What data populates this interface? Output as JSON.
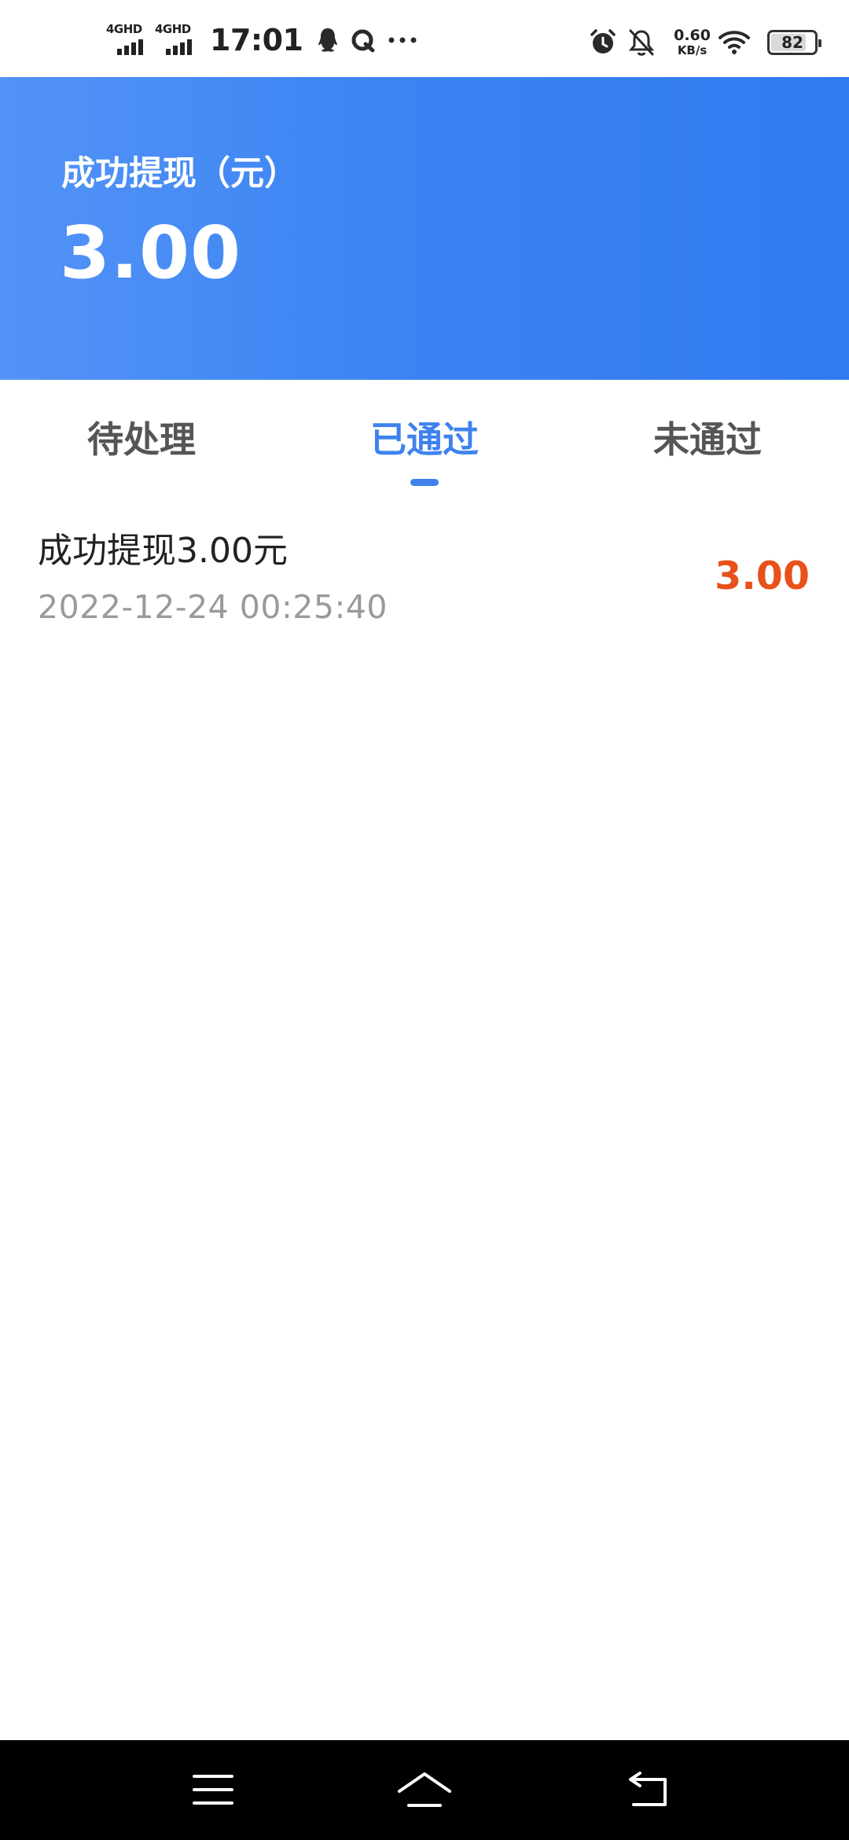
{
  "status_bar": {
    "signal_1_label": "4GHD",
    "signal_2_label": "4GHD",
    "time": "17:01",
    "notification_icons": [
      "qq-icon",
      "browser-icon",
      "more-dots-icon"
    ],
    "net_speed_value": "0.60",
    "net_speed_unit": "KB/s",
    "battery_level": "82",
    "battery_fraction": 0.82
  },
  "summary": {
    "label": "成功提现（元）",
    "amount": "3.00"
  },
  "tabs": [
    {
      "label": "待处理",
      "active": false
    },
    {
      "label": "已通过",
      "active": true
    },
    {
      "label": "未通过",
      "active": false
    }
  ],
  "records": [
    {
      "title": "成功提现3.00元",
      "date": "2022-12-24 00:25:40",
      "amount": "3.00"
    }
  ],
  "nav_bar": {
    "icons": [
      "menu-icon",
      "home-icon",
      "back-icon"
    ]
  },
  "colors": {
    "banner_gradient_start": "#5393f7",
    "banner_gradient_end": "#2f7bef",
    "active_tab": "#3f82ee",
    "inactive_tab": "#555555",
    "record_amount": "#e8511a",
    "record_date": "#9a9a9a"
  }
}
